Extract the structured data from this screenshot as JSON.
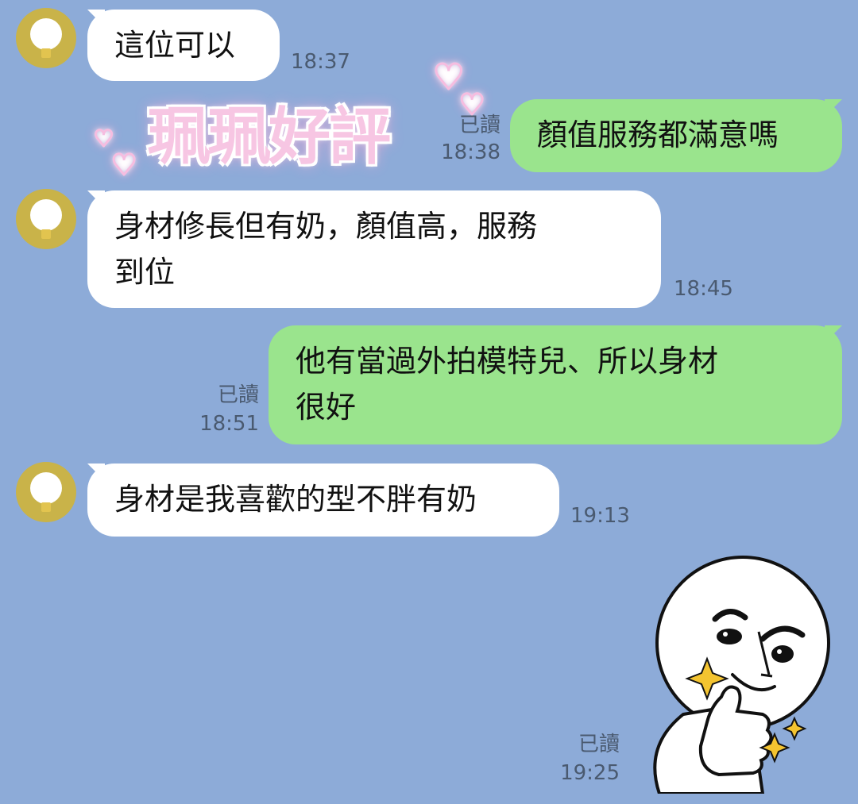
{
  "messages": [
    {
      "text": "這位可以",
      "time": "18:37"
    },
    {
      "text": "顏值服務都滿意嗎",
      "read": "已讀",
      "time": "18:38"
    },
    {
      "line1": "身材修長但有奶，顏值高，服務",
      "line2": "到位",
      "time": "18:45"
    },
    {
      "line1": "他有當過外拍模特兒、所以身材",
      "line2": "很好",
      "read": "已讀",
      "time": "18:51"
    },
    {
      "text": "身材是我喜歡的型不胖有奶",
      "time": "19:13"
    },
    {
      "read": "已讀",
      "time": "19:25"
    }
  ],
  "overlay": {
    "sticker_text": "珮珮好評"
  },
  "colors": {
    "background": "#8dabd8",
    "incoming_bubble": "#ffffff",
    "outgoing_bubble": "#9ae48d",
    "avatar": "#c9b349"
  },
  "icons": {
    "avatar": "lightbulb-avatar-icon",
    "sticker": "thumbs-up-face-sticker",
    "hearts": "heart-icon"
  }
}
